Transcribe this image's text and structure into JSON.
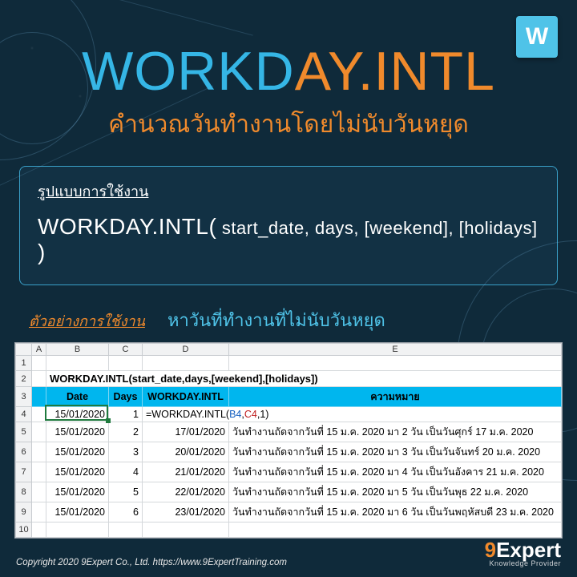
{
  "badge": "W",
  "title": {
    "part1": "WORKD",
    "part2": "AY.INTL"
  },
  "subtitle": "คำนวณวันทำงานโดยไม่นับวันหยุด",
  "syntax": {
    "label": "รูปแบบการใช้งาน",
    "fn": "WORKDAY.INTL(",
    "args": " start_date, days, [weekend], [holidays] ",
    "close": ")"
  },
  "example": {
    "label": "ตัวอย่างการใช้งาน",
    "desc": "หาวันที่ทำงานที่ไม่นับวันหยุด"
  },
  "sheet": {
    "cols": [
      "A",
      "B",
      "C",
      "D",
      "E"
    ],
    "sig": "WORKDAY.INTL(start_date,days,[weekend],[holidays])",
    "headers": {
      "date": "Date",
      "days": "Days",
      "fn": "WORKDAY.INTL",
      "meaning": "ความหมาย"
    },
    "formula": {
      "pre": "=WORKDAY.INTL(",
      "ref1": "B4",
      "sep1": ",",
      "ref2": "C4",
      "post": ",1)"
    },
    "rows": [
      {
        "n": 4,
        "date": "15/01/2020",
        "days": "1",
        "result": "",
        "meaning": ""
      },
      {
        "n": 5,
        "date": "15/01/2020",
        "days": "2",
        "result": "17/01/2020",
        "meaning": "วันทำงานถัดจากวันที่ 15 ม.ค. 2020 มา 2 วัน เป็นวันศุกร์  17 ม.ค. 2020"
      },
      {
        "n": 6,
        "date": "15/01/2020",
        "days": "3",
        "result": "20/01/2020",
        "meaning": "วันทำงานถัดจากวันที่ 15 ม.ค. 2020 มา 3 วัน เป็นวันจันทร์  20 ม.ค. 2020"
      },
      {
        "n": 7,
        "date": "15/01/2020",
        "days": "4",
        "result": "21/01/2020",
        "meaning": "วันทำงานถัดจากวันที่ 15 ม.ค. 2020 มา 4 วัน เป็นวันอังคาร  21 ม.ค. 2020"
      },
      {
        "n": 8,
        "date": "15/01/2020",
        "days": "5",
        "result": "22/01/2020",
        "meaning": "วันทำงานถัดจากวันที่ 15 ม.ค. 2020 มา 5 วัน เป็นวันพุธ  22 ม.ค. 2020"
      },
      {
        "n": 9,
        "date": "15/01/2020",
        "days": "6",
        "result": "23/01/2020",
        "meaning": "วันทำงานถัดจากวันที่ 15 ม.ค. 2020 มา 6 วัน เป็นวันพฤหัสบดี  23 ม.ค. 2020"
      }
    ]
  },
  "footer": {
    "copyright": "Copyright 2020 9Expert Co., Ltd.   https://www.9ExpertTraining.com",
    "brand_nine": "9",
    "brand_rest": "Expert",
    "brand_sub": "Knowledge Provider"
  }
}
